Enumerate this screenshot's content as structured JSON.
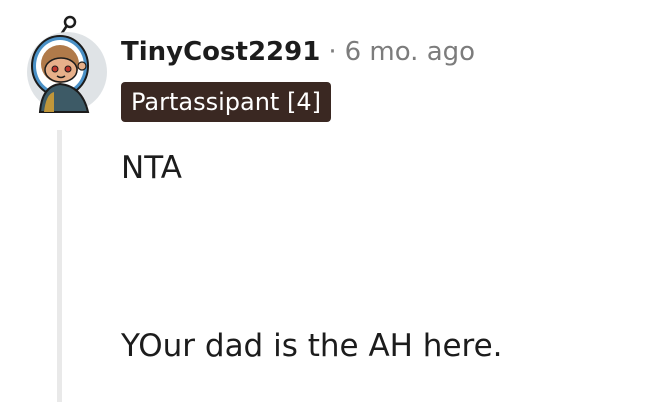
{
  "comment": {
    "username": "TinyCost2291",
    "separator": "·",
    "timestamp": "6 mo. ago",
    "flair": "Partassipant [4]",
    "body": {
      "line1": "NTA",
      "line2": "YOur dad is the AH here."
    }
  },
  "colors": {
    "flair_bg": "#3a2822",
    "flair_text": "#ffffff",
    "username": "#1c1c1c",
    "meta": "#7c7c7c",
    "thread_line": "#e9e9e9"
  },
  "icons": {
    "avatar": "snoo-avatar-icon"
  }
}
